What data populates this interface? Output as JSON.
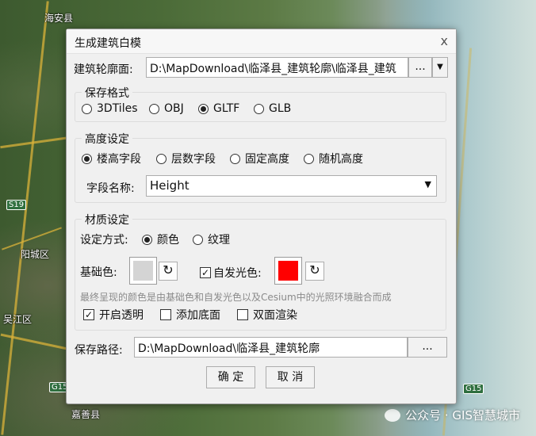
{
  "map": {
    "places": [
      "海安县",
      "阳城区",
      "吴江区",
      "嘉善县"
    ],
    "route_shields": [
      "S19",
      "G15",
      "G15"
    ]
  },
  "watermark": {
    "text": "公众号 · GIS智慧城市"
  },
  "dialog": {
    "title": "生成建筑白模",
    "close_glyph": "x",
    "source": {
      "label": "建筑轮廓面:",
      "value": "D:\\MapDownload\\临泽县_建筑轮廓\\临泽县_建筑",
      "browse_label": "...",
      "dropdown_glyph": "▼"
    },
    "format_group": {
      "title": "保存格式",
      "options": [
        "3DTiles",
        "OBJ",
        "GLTF",
        "GLB"
      ],
      "selected": "GLTF"
    },
    "height_group": {
      "title": "高度设定",
      "options": [
        "楼高字段",
        "层数字段",
        "固定高度",
        "随机高度"
      ],
      "selected": "楼高字段",
      "field_label": "字段名称:",
      "field_value": "Height",
      "dropdown_glyph": "▼"
    },
    "material_group": {
      "title": "材质设定",
      "mode_label": "设定方式:",
      "mode_options": [
        "颜色",
        "纹理"
      ],
      "mode_selected": "颜色",
      "base_color_label": "基础色:",
      "base_color": "#d4d4d4",
      "emissive_label": "自发光色:",
      "emissive_checked": true,
      "emissive_color": "#ff0000",
      "reset_glyph": "↻",
      "hint": "最终呈现的颜色是由基础色和自发光色以及Cesium中的光照环境融合而成",
      "options": [
        {
          "label": "开启透明",
          "checked": true
        },
        {
          "label": "添加底面",
          "checked": false
        },
        {
          "label": "双面渲染",
          "checked": false
        }
      ]
    },
    "output": {
      "label": "保存路径:",
      "value": "D:\\MapDownload\\临泽县_建筑轮廓",
      "browse_label": "..."
    },
    "ok_label": "确 定",
    "cancel_label": "取 消"
  }
}
